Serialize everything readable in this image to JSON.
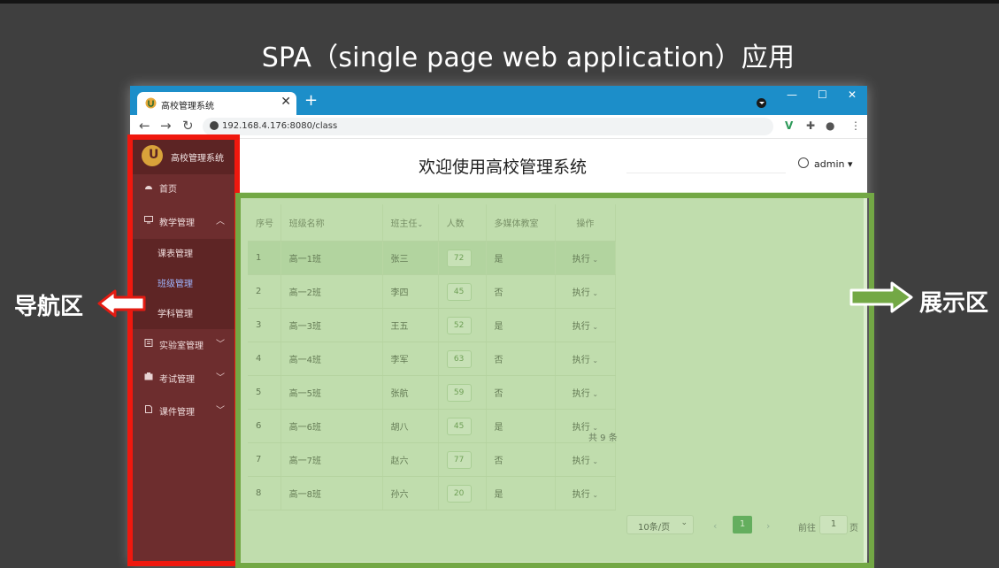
{
  "slide": {
    "title": "SPA（single page web application）应用"
  },
  "labels": {
    "nav_area": "导航区",
    "display_area": "展示区"
  },
  "browser": {
    "tab_title": "高校管理系统",
    "url": "192.168.4.176:8080/class",
    "tab_close": "✕",
    "new_tab": "+",
    "min": "—",
    "max": "☐",
    "close": "✕",
    "back": "←",
    "forward": "→",
    "reload": "↻"
  },
  "app": {
    "brand": "高校管理系统",
    "logo_letter": "U",
    "welcome": "欢迎使用高校管理系统",
    "user": "admin",
    "menu": [
      {
        "label": "首页",
        "icon": "dashboard-icon"
      },
      {
        "label": "教学管理",
        "icon": "monitor-icon",
        "expanded": true
      },
      {
        "label": "课表管理",
        "sub": true
      },
      {
        "label": "班级管理",
        "sub": true,
        "active": true
      },
      {
        "label": "学科管理",
        "sub": true
      },
      {
        "label": "实验室管理",
        "icon": "document-icon"
      },
      {
        "label": "考试管理",
        "icon": "clipboard-icon"
      },
      {
        "label": "课件管理",
        "icon": "file-icon"
      }
    ],
    "table": {
      "headers": [
        "序号",
        "班级名称",
        "班主任",
        "人数",
        "多媒体教室",
        "操作"
      ],
      "rows": [
        [
          "1",
          "高一1班",
          "张三",
          "72",
          "是",
          "执行"
        ],
        [
          "2",
          "高一2班",
          "李四",
          "45",
          "否",
          "执行"
        ],
        [
          "3",
          "高一3班",
          "王五",
          "52",
          "是",
          "执行"
        ],
        [
          "4",
          "高一4班",
          "李军",
          "63",
          "否",
          "执行"
        ],
        [
          "5",
          "高一5班",
          "张航",
          "59",
          "否",
          "执行"
        ],
        [
          "6",
          "高一6班",
          "胡八",
          "45",
          "是",
          "执行"
        ],
        [
          "7",
          "高一7班",
          "赵六",
          "77",
          "否",
          "执行"
        ],
        [
          "8",
          "高一8班",
          "孙六",
          "20",
          "是",
          "执行"
        ]
      ]
    },
    "pagination": {
      "total": "共 9 条",
      "page_size": "10条/页",
      "current_page": "1",
      "goto_label": "前往",
      "goto_value": "1",
      "page_unit": "页"
    }
  },
  "colors": {
    "sidebar": "#6d2d2e",
    "red_frame": "#f0180e",
    "green_frame": "#73a845",
    "browser_bar": "#1c8ec9"
  }
}
